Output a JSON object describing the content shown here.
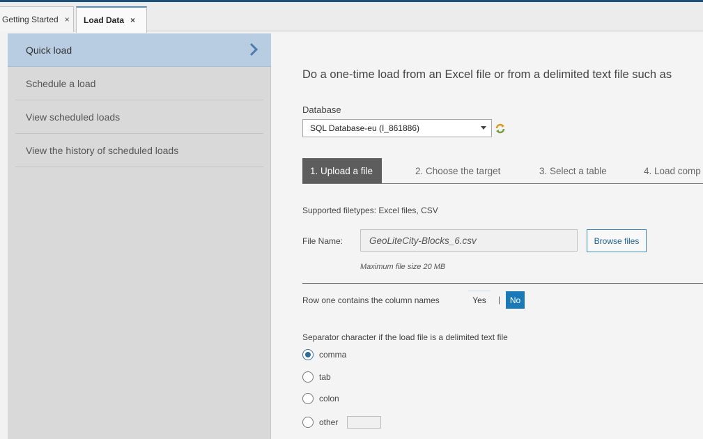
{
  "tabs": [
    {
      "label": "Getting Started",
      "close": "×"
    },
    {
      "label": "Load Data",
      "close": "×"
    }
  ],
  "sidebar": {
    "items": [
      {
        "label": "Quick load",
        "active": true
      },
      {
        "label": "Schedule a load"
      },
      {
        "label": "View scheduled loads"
      },
      {
        "label": "View the history of scheduled loads"
      }
    ],
    "active_chevron_icon": "chevron-right-icon"
  },
  "main": {
    "heading": "Do a one-time load from an Excel file or from a delimited text file such as",
    "database": {
      "label": "Database",
      "selected": "SQL Database-eu (I_861886)",
      "refresh_icon": "refresh-icon"
    },
    "steps": [
      {
        "label": "1. Upload a file",
        "active": true
      },
      {
        "label": "2. Choose the target"
      },
      {
        "label": "3. Select a table"
      },
      {
        "label": "4. Load comp"
      }
    ],
    "filetypes": "Supported filetypes: Excel files, CSV",
    "file_name": {
      "label": "File Name:",
      "value": "GeoLiteCity-Blocks_6.csv",
      "browse_label": "Browse files",
      "max_size": "Maximum file size 20 MB"
    },
    "column_names": {
      "label": "Row one contains the column names",
      "yes": "Yes",
      "separator": "|",
      "no": "No",
      "selected": "No"
    },
    "separator": {
      "label": "Separator character if the load file is a delimited text file",
      "options": [
        {
          "label": "comma",
          "checked": true
        },
        {
          "label": "tab"
        },
        {
          "label": "colon"
        },
        {
          "label": "other"
        }
      ]
    }
  },
  "colors": {
    "accent": "#1a7ab8",
    "active_sidebar": "#b9cde2",
    "active_step": "#5d5d5d"
  }
}
